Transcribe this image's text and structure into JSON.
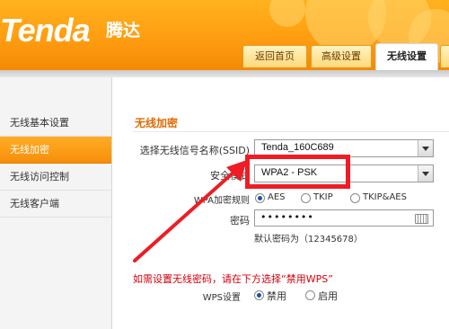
{
  "header": {
    "logo_text": "Tenda",
    "logo_cn": "腾达",
    "tabs": [
      {
        "label": "返回首页",
        "active": false
      },
      {
        "label": "高级设置",
        "active": false
      },
      {
        "label": "无线设置",
        "active": true
      }
    ]
  },
  "sidebar": {
    "items": [
      {
        "label": "无线基本设置",
        "active": false
      },
      {
        "label": "无线加密",
        "active": true
      },
      {
        "label": "无线访问控制",
        "active": false
      },
      {
        "label": "无线客户端",
        "active": false
      }
    ]
  },
  "main": {
    "section_title": "无线加密",
    "ssid": {
      "label": "选择无线信号名称(SSID)",
      "value": "Tenda_160C689"
    },
    "security_mode": {
      "label": "安全模式",
      "value": "WPA2 - PSK"
    },
    "wpa_algorithm": {
      "label": "WPA加密规则",
      "options": [
        {
          "label": "AES",
          "checked": true
        },
        {
          "label": "TKIP",
          "checked": false
        },
        {
          "label": "TKIP&AES",
          "checked": false
        }
      ]
    },
    "password": {
      "label": "密码",
      "value": "••••••••",
      "default_hint": "默认密码为（12345678）"
    },
    "wps_note": "如需设置无线密码，请在下方选择“禁用WPS”",
    "wps": {
      "label": "WPS设置",
      "options": [
        {
          "label": "禁用",
          "checked": true
        },
        {
          "label": "启用",
          "checked": false
        }
      ]
    }
  },
  "annotation": {
    "color": "#ee1c25"
  }
}
